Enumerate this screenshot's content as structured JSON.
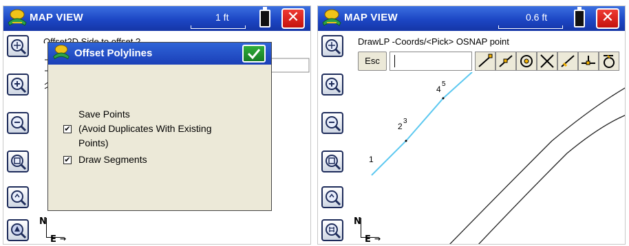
{
  "left": {
    "title": "MAP VIEW",
    "scale": "1 ft",
    "command_text": "Offset2D  Side to offset ?",
    "dialog": {
      "title": "Offset Polylines",
      "save_points_line1": "Save Points",
      "save_points_line2": "(Avoid Duplicates With Existing",
      "save_points_line3": "Points)",
      "save_points_checked": true,
      "draw_segments": "Draw Segments",
      "draw_segments_checked": true,
      "check_mark": "✔"
    },
    "north": "N",
    "east": "E"
  },
  "right": {
    "title": "MAP VIEW",
    "scale": "0.6 ft",
    "command_text": "DrawLP  -Coords/<Pick> OSNAP point",
    "esc_label": "Esc",
    "points": [
      {
        "id": "1",
        "sup": ""
      },
      {
        "id": "2",
        "sup": "3"
      },
      {
        "id": "4",
        "sup": "5"
      }
    ],
    "north": "N",
    "east": "E"
  },
  "colors": {
    "titlebar": "#1c46c4",
    "close": "#d8231d",
    "ok": "#2fae3a",
    "dialog_bg": "#ece9d8",
    "polyline": "#5cc8f0"
  }
}
